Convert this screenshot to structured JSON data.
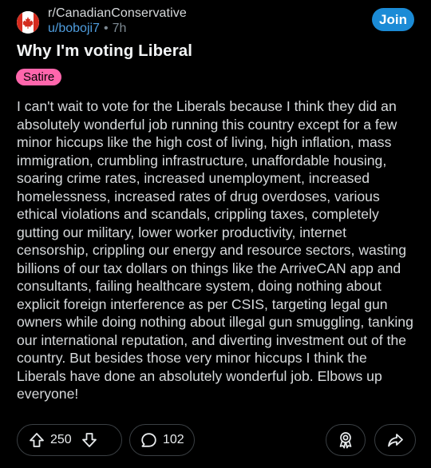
{
  "header": {
    "subreddit": "r/CanadianConservative",
    "username": "u/boboji7",
    "separator": "•",
    "time_ago": "7h",
    "join_label": "Join",
    "avatar_icon": "canada-flag-icon"
  },
  "post": {
    "title": "Why I'm voting Liberal",
    "flair": "Satire",
    "body": "I can't wait to vote for the Liberals because I think they did an absolutely wonderful job running this country except for a few minor hiccups like the high cost of living, high inflation, mass immigration, crumbling infrastructure, unaffordable housing, soaring crime rates, increased unemployment, increased homelessness, increased rates of drug overdoses, various ethical violations and scandals, crippling taxes, completely gutting our military, lower worker productivity, internet censorship, crippling our energy and resource sectors, wasting billions of our tax dollars on things like the ArriveCAN app and consultants, failing healthcare system, doing nothing about explicit foreign interference as per CSIS, targeting legal gun owners while doing nothing about illegal gun smuggling, tanking our international reputation, and diverting investment out of the country. But besides those very minor hiccups I think the Liberals have done an absolutely wonderful job. Elbows up everyone!"
  },
  "actions": {
    "score": "250",
    "comments": "102",
    "upvote_icon": "upvote-arrow-icon",
    "downvote_icon": "downvote-arrow-icon",
    "comment_icon": "comment-bubble-icon",
    "award_icon": "award-icon",
    "share_icon": "share-arrow-icon"
  },
  "colors": {
    "background": "#000000",
    "join_button": "#1b8bd6",
    "flair": "#ff66ac",
    "username": "#4f9dde",
    "text": "#d7dadc"
  }
}
